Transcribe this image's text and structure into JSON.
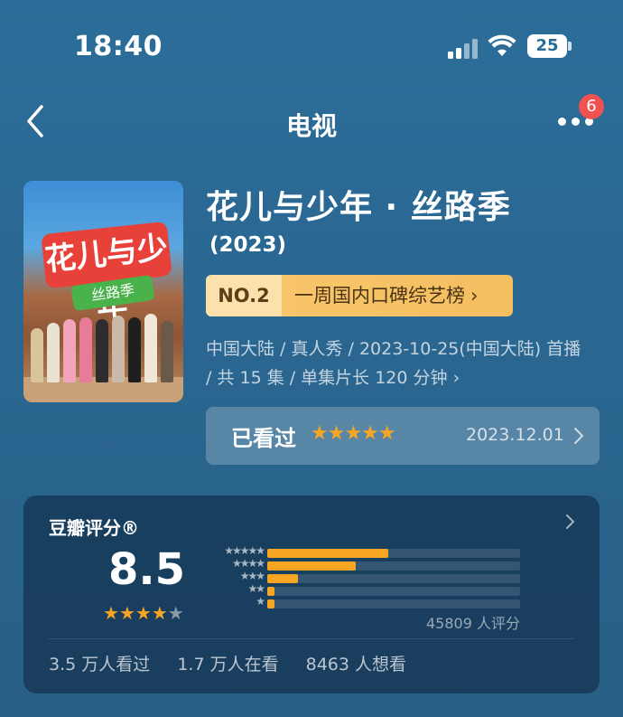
{
  "status_bar": {
    "time": "18:40",
    "battery": "25"
  },
  "nav": {
    "title": "电视",
    "badge_count": "6"
  },
  "show": {
    "title": "花儿与少年 · 丝路季",
    "year": "(2023)",
    "rank_no": "NO.2",
    "rank_label": "一周国内口碑综艺榜",
    "meta": "中国大陆 / 真人秀 / 2023-10-25(中国大陆) 首播 / 共 15 集 / 单集片长 120 分钟",
    "poster_title": "花儿与少年",
    "poster_subtitle": "丝路季"
  },
  "watched": {
    "label": "已看过",
    "stars": 5,
    "date": "2023.12.01"
  },
  "rating": {
    "title": "豆瓣评分®",
    "score": "8.5",
    "stars_filled": 4,
    "stars_total": 5,
    "distribution": [
      {
        "stars": 5,
        "percent": 48
      },
      {
        "stars": 4,
        "percent": 35
      },
      {
        "stars": 3,
        "percent": 12
      },
      {
        "stars": 2,
        "percent": 3
      },
      {
        "stars": 1,
        "percent": 3
      }
    ],
    "votes": "45809 人评分"
  },
  "stats": {
    "watched": "3.5 万人看过",
    "watching": "1.7 万人在看",
    "want": "8463 人想看"
  },
  "colors": {
    "accent_star": "#f6a623",
    "badge_red": "#f05151",
    "rank_gold": "#f8c56a"
  }
}
